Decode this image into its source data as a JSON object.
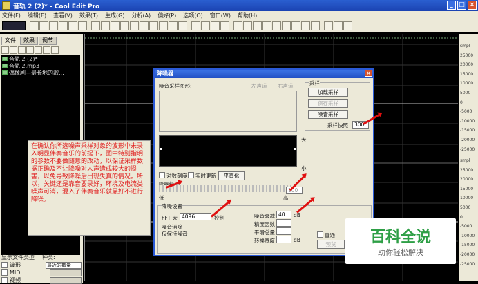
{
  "window": {
    "title": "音轨  2 (2)* - Cool Edit Pro",
    "controls": [
      "_",
      "□",
      "×"
    ]
  },
  "menu": [
    "文件(F)",
    "编辑(E)",
    "查看(V)",
    "效果(T)",
    "生成(G)",
    "分析(A)",
    "偏好(P)",
    "选项(O)",
    "窗口(W)",
    "帮助(H)"
  ],
  "left": {
    "tabs": [
      "文件",
      "效果",
      "调节"
    ],
    "files": [
      "音轨  2 (2)*",
      "音轨  2.mp3",
      "偶像剧—最长地的歌..."
    ],
    "show_type_label": "显示文件类型",
    "kind_label": "种类:",
    "kind_value": "最近的数量",
    "types": [
      "波形",
      "MIDI",
      "视频"
    ]
  },
  "ruler": {
    "labels": [
      "smpl",
      "25000",
      "20000",
      "15000",
      "10000",
      "5000",
      "0",
      "-5000",
      "-10000",
      "-15000",
      "-20000",
      "-25000",
      "smpl",
      "25000",
      "20000",
      "15000",
      "10000",
      "5000",
      "0",
      "-5000",
      "-10000",
      "-15000",
      "-20000",
      "-25000"
    ]
  },
  "dialog": {
    "title": "降噪器",
    "profile_label": "噪音采样图形:",
    "left_channel": "左声道",
    "right_channel": "右声道",
    "sample_group": "采样",
    "btn_load": "加载采样",
    "btn_save": "保存采样",
    "btn_get": "噪音采样",
    "snapshot_label": "采样快照",
    "snapshot_value": "300",
    "big": "大",
    "small": "小",
    "log_scale": "对数刻度",
    "live_update": "实时更新",
    "flat": "平直化",
    "level_label": "降噪级别",
    "low": "低",
    "high": "高",
    "level_value": "100",
    "settings_label": "降噪设置",
    "fft_label": "FFT 大",
    "fft_value": "4096",
    "control": "控制",
    "remove": "噪音消除",
    "keep": "仅保持噪音",
    "decay_label": "噪音衰减",
    "decay_value": "40",
    "decay_unit": "dB",
    "precision_label": "精度因数",
    "smooth_label": "平滑总量",
    "transition_label": "转换宽度",
    "transition_unit": "dB",
    "bypass": "直通",
    "preview": "预览"
  },
  "annotation": "在确认你所选噪声采样对象的波形中未录入明显伴奏音乐的前提下，图中特别指明的参数不要做随意的改动，以保证采样数据正确及不让降噪对人声造成较大的损害，以免导致降噪后出现失真的情况。所以，关键还是靠音要录好，环境及电流类噪声可消，混入了伴奏音乐就最好不进行降噪。",
  "brand": {
    "name": "百科全说",
    "slogan": "助你轻松解决"
  }
}
